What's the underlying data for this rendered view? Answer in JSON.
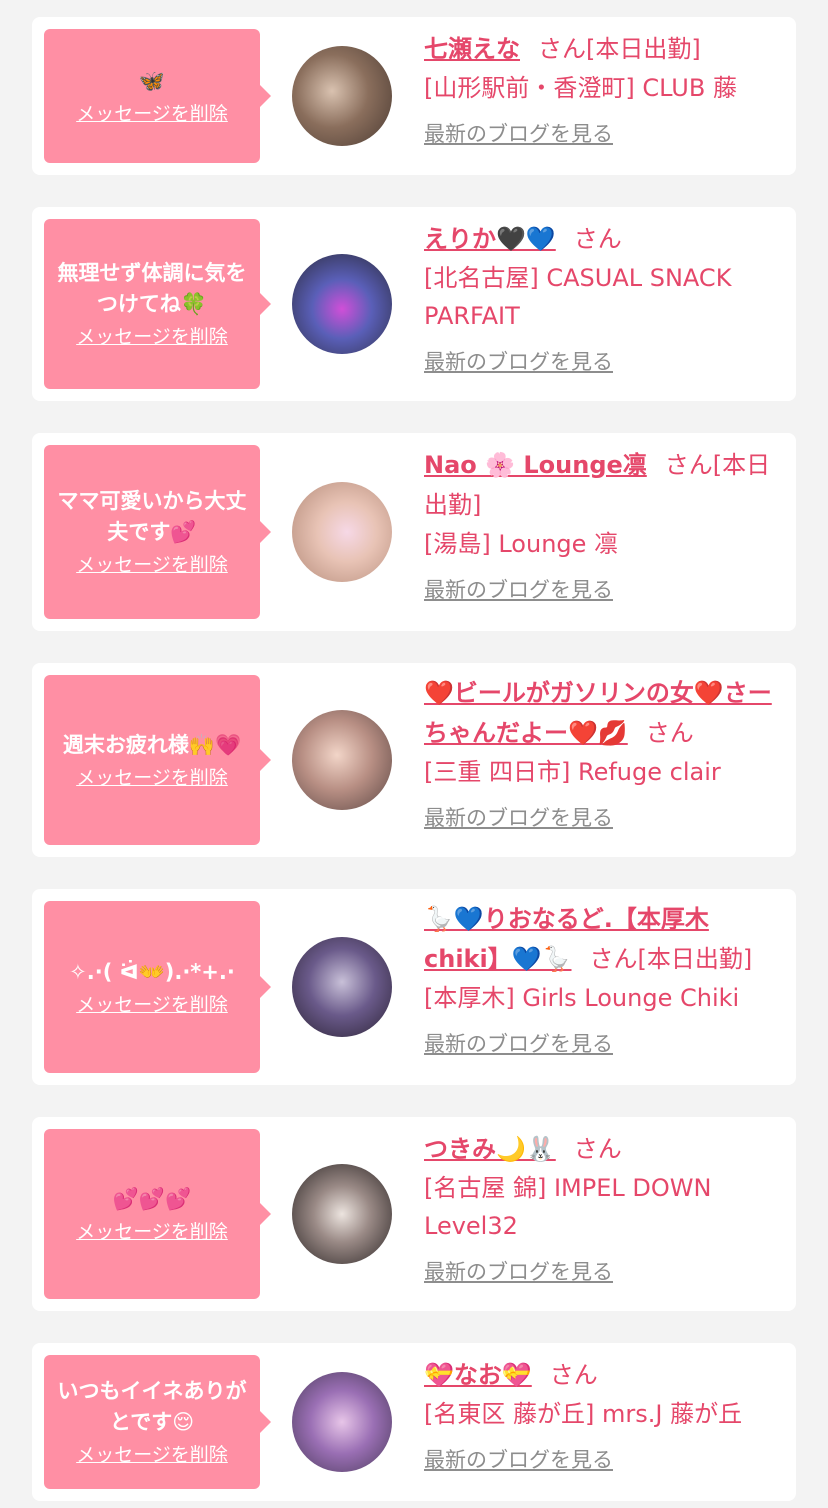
{
  "delete_label": "メッセージを削除",
  "honorific": "さん",
  "blog_label": "最新のブログを見る",
  "colors": {
    "accent_pink": "#ff8fa4",
    "name_pink": "#e5476a",
    "link_gray": "#8d8d8d",
    "background": "#f3f3f3"
  },
  "entries": [
    {
      "message": "🦋",
      "name": "七瀬えな",
      "status": "[本日出勤]",
      "shop": "[山形駅前・香澄町] CLUB 藤",
      "avatar_icon": "profile-photo"
    },
    {
      "message": "無理せず体調に気をつけてね🍀",
      "name": "えりか🖤💙",
      "status": "",
      "shop": "[北名古屋] CASUAL SNACK PARFAIT",
      "avatar_icon": "profile-photo"
    },
    {
      "message": "ママ可愛いから大丈夫です💕",
      "name": "Nao 🌸 Lounge凛",
      "status": "[本日出勤]",
      "shop": "[湯島] Lounge 凛",
      "avatar_icon": "profile-photo"
    },
    {
      "message": "週末お疲れ様🙌💗",
      "name": "❤️ビールがガソリンの女❤️さーちゃんだよー❤️💋",
      "status": "",
      "shop": "[三重 四日市] Refuge clair",
      "avatar_icon": "profile-photo"
    },
    {
      "message": "✧.·( ᐛ👐).·*+.·",
      "name": "🪿💙りおなるど.【本厚木chiki】💙🪿",
      "status": "[本日出勤]",
      "shop": "[本厚木] Girls Lounge Chiki",
      "avatar_icon": "profile-photo"
    },
    {
      "message": "💕💕💕",
      "name": "つきみ🌙🐰",
      "status": "",
      "shop": "[名古屋 錦] IMPEL DOWN Level32",
      "avatar_icon": "profile-photo"
    },
    {
      "message": "いつもイイネありがとです😌",
      "name": "💝なお💝",
      "status": "",
      "shop": "[名東区 藤が丘] mrs.J 藤が丘",
      "avatar_icon": "profile-photo"
    }
  ]
}
